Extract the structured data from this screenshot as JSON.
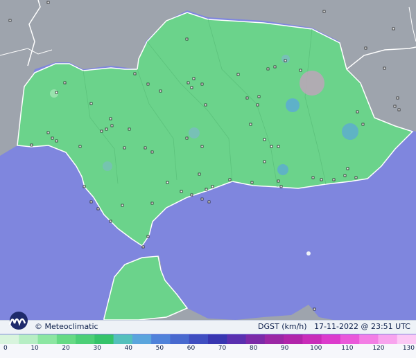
{
  "map": {
    "land_color": "#6bd38b",
    "sea_color": "#7f86de",
    "outside_color": "#9ea4ad"
  },
  "footer": {
    "credit": "© Meteoclimatic",
    "variable": "DGST (km/h)",
    "timestamp": "17-11-2022 @ 23:51 UTC"
  },
  "legend": {
    "ticks": [
      "0",
      "10",
      "20",
      "30",
      "40",
      "50",
      "60",
      "70",
      "80",
      "90",
      "100",
      "110",
      "120",
      "130"
    ],
    "colors": [
      "#d8f4dd",
      "#b6eec4",
      "#8ce6a2",
      "#66da85",
      "#4ccf77",
      "#35c36a",
      "#54c0bc",
      "#5aa5dd",
      "#4f82da",
      "#4869cf",
      "#3f4ec1",
      "#3836b1",
      "#5a30b0",
      "#7c2aa8",
      "#9b27a5",
      "#b125aa",
      "#c92cb9",
      "#dc3bcc",
      "#ea58da",
      "#f37ee5",
      "#f8a4ee",
      "#fcc9f5"
    ]
  }
}
